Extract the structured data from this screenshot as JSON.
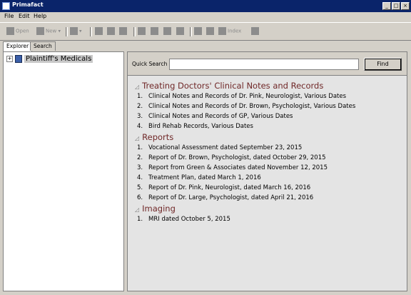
{
  "window": {
    "title": "Primafact",
    "minimize": "_",
    "maximize": "□",
    "close": "×"
  },
  "menu": [
    "File",
    "Edit",
    "Help"
  ],
  "toolbar": {
    "open": "Open",
    "new": "New",
    "index": "Index"
  },
  "tabs": [
    "Explorer",
    "Search"
  ],
  "tree": {
    "root_label": "Plaintiff's Medicals",
    "expander": "+"
  },
  "search": {
    "label": "Quick Search :",
    "value": "",
    "find_label": "Find"
  },
  "sections": [
    {
      "title": "Treating Doctors' Clinical Notes and Records",
      "items": [
        {
          "num": "1.",
          "text": "Clinical Notes and Records of Dr. Pink, Neurologist, Various Dates"
        },
        {
          "num": "2.",
          "text": "Clinical Notes and Records of Dr. Brown, Psychologist, Various Dates"
        },
        {
          "num": "3.",
          "text": "Clinical Notes and Records of GP, Various Dates"
        },
        {
          "num": "4.",
          "text": "Bird Rehab Records, Various Dates"
        }
      ]
    },
    {
      "title": "Reports",
      "items": [
        {
          "num": "1.",
          "text": "Vocational Assessment dated September 23, 2015"
        },
        {
          "num": "2.",
          "text": "Report of Dr. Brown, Psychologist, dated October 29, 2015"
        },
        {
          "num": "3.",
          "text": "Report from Green & Associates dated November 12, 2015"
        },
        {
          "num": "4.",
          "text": "Treatment Plan, dated March 1, 2016"
        },
        {
          "num": "5.",
          "text": "Report of Dr. Pink, Neurologist, dated March 16, 2016"
        },
        {
          "num": "6.",
          "text": "Report of Dr. Large, Psychologist, dated April 21, 2016"
        }
      ]
    },
    {
      "title": "Imaging",
      "items": [
        {
          "num": "1.",
          "text": "MRI dated October 5, 2015"
        }
      ]
    }
  ]
}
